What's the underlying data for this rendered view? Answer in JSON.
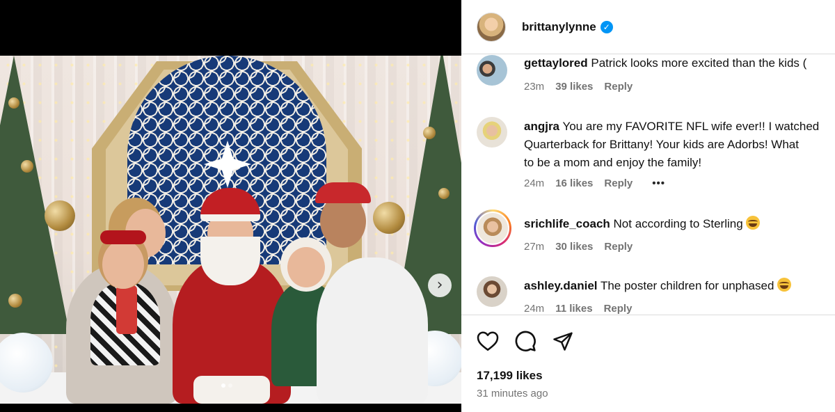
{
  "post": {
    "author": "brittanylynne",
    "verified_icon": "verified-badge-icon",
    "likes": "17,199 likes",
    "time": "31 minutes ago",
    "carousel": {
      "current": 1,
      "total": 2
    }
  },
  "comments": [
    {
      "user": "gettaylored",
      "text": "Patrick looks more excited than the kids (",
      "time": "23m",
      "likes": "39 likes",
      "reply": "Reply"
    },
    {
      "user": "angjra",
      "text_lines": [
        "You are my FAVORITE NFL wife ever!! I watched",
        "Quarterback for Brittany! Your kids are Adorbs! What",
        "to be a mom and enjoy the family!"
      ],
      "time": "24m",
      "likes": "16 likes",
      "reply": "Reply",
      "more": "•••"
    },
    {
      "user": "srichlife_coach",
      "text": "Not according to Sterling",
      "time": "27m",
      "likes": "30 likes",
      "reply": "Reply"
    },
    {
      "user": "ashley.daniel",
      "text": "The poster children for unphased",
      "time": "24m",
      "likes": "11 likes",
      "reply": "Reply"
    }
  ],
  "colors": {
    "link_blue": "#0095f6",
    "secondary_text": "#737373",
    "border": "#dbdbdb"
  },
  "icons": [
    "heart-icon",
    "comment-icon",
    "share-icon",
    "chevron-right-icon",
    "laughing-emoji-icon"
  ]
}
